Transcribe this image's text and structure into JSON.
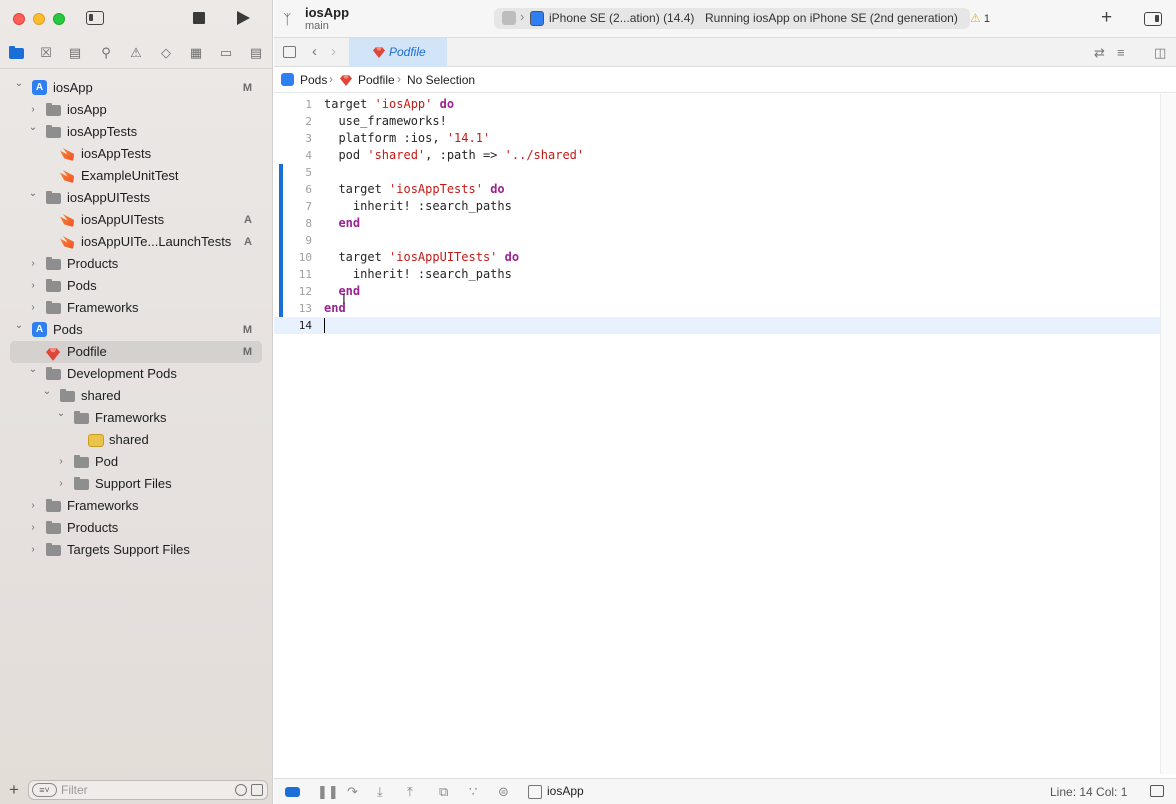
{
  "toolbar": {
    "project_name": "iosApp",
    "branch": "main",
    "device": "iPhone SE (2...ation) (14.4)",
    "run_status": "Running iosApp on iPhone SE (2nd generation)",
    "warning_count": "1"
  },
  "navigator": {
    "tree": [
      {
        "label": "iosApp",
        "icon": "project-icon",
        "level": 0,
        "expanded": true,
        "badge": "M"
      },
      {
        "label": "iosApp",
        "icon": "folder-icon",
        "level": 1,
        "expanded": false,
        "badge": ""
      },
      {
        "label": "iosAppTests",
        "icon": "folder-icon",
        "level": 1,
        "expanded": true,
        "badge": ""
      },
      {
        "label": "iosAppTests",
        "icon": "swift-file-icon",
        "level": 2,
        "badge": ""
      },
      {
        "label": "ExampleUnitTest",
        "icon": "swift-file-icon",
        "level": 2,
        "badge": ""
      },
      {
        "label": "iosAppUITests",
        "icon": "folder-icon",
        "level": 1,
        "expanded": true,
        "badge": ""
      },
      {
        "label": "iosAppUITests",
        "icon": "swift-file-icon",
        "level": 2,
        "badge": "A"
      },
      {
        "label": "iosAppUITe...LaunchTests",
        "icon": "swift-file-icon",
        "level": 2,
        "badge": "A"
      },
      {
        "label": "Products",
        "icon": "folder-icon",
        "level": 1,
        "expanded": false,
        "badge": ""
      },
      {
        "label": "Pods",
        "icon": "folder-icon",
        "level": 1,
        "expanded": false,
        "badge": ""
      },
      {
        "label": "Frameworks",
        "icon": "folder-icon",
        "level": 1,
        "expanded": false,
        "badge": ""
      },
      {
        "label": "Pods",
        "icon": "project-icon",
        "level": 0,
        "expanded": true,
        "badge": "M"
      },
      {
        "label": "Podfile",
        "icon": "ruby-icon",
        "level": 1,
        "badge": "M",
        "selected": true
      },
      {
        "label": "Development Pods",
        "icon": "folder-icon",
        "level": 1,
        "expanded": true,
        "badge": ""
      },
      {
        "label": "shared",
        "icon": "folder-icon",
        "level": 2,
        "expanded": true,
        "badge": ""
      },
      {
        "label": "Frameworks",
        "icon": "folder-icon",
        "level": 3,
        "expanded": true,
        "badge": ""
      },
      {
        "label": "shared",
        "icon": "framework-icon",
        "level": 4,
        "badge": ""
      },
      {
        "label": "Pod",
        "icon": "folder-icon",
        "level": 3,
        "expanded": false,
        "badge": ""
      },
      {
        "label": "Support Files",
        "icon": "folder-icon",
        "level": 3,
        "expanded": false,
        "badge": ""
      },
      {
        "label": "Frameworks",
        "icon": "folder-icon",
        "level": 1,
        "expanded": false,
        "badge": ""
      },
      {
        "label": "Products",
        "icon": "folder-icon",
        "level": 1,
        "expanded": false,
        "badge": ""
      },
      {
        "label": "Targets Support Files",
        "icon": "folder-icon",
        "level": 1,
        "expanded": false,
        "badge": ""
      }
    ],
    "filter_placeholder": "Filter"
  },
  "editor": {
    "tab_label": "Podfile",
    "jumpbar": [
      "Pods",
      "Podfile",
      "No Selection"
    ],
    "current_line": 14,
    "lines": [
      [
        [
          "t",
          "target "
        ],
        [
          "s",
          "'iosApp'"
        ],
        [
          "t",
          " "
        ],
        [
          "k",
          "do"
        ]
      ],
      [
        [
          "t",
          "  use_frameworks!"
        ]
      ],
      [
        [
          "t",
          "  platform :ios, "
        ],
        [
          "s",
          "'14.1'"
        ]
      ],
      [
        [
          "t",
          "  pod "
        ],
        [
          "s",
          "'shared'"
        ],
        [
          "t",
          ", :path => "
        ],
        [
          "s",
          "'../shared'"
        ]
      ],
      [],
      [
        [
          "t",
          "  target "
        ],
        [
          "s",
          "'iosAppTests'"
        ],
        [
          "t",
          " "
        ],
        [
          "k",
          "do"
        ]
      ],
      [
        [
          "t",
          "    inherit! :search_paths"
        ]
      ],
      [
        [
          "t",
          "  "
        ],
        [
          "k",
          "end"
        ]
      ],
      [],
      [
        [
          "t",
          "  target "
        ],
        [
          "s",
          "'iosAppUITests'"
        ],
        [
          "t",
          " "
        ],
        [
          "k",
          "do"
        ]
      ],
      [
        [
          "t",
          "    inherit! :search_paths"
        ]
      ],
      [
        [
          "t",
          "  "
        ],
        [
          "k",
          "end"
        ]
      ],
      [
        [
          "k",
          "end"
        ]
      ],
      []
    ]
  },
  "debugbar": {
    "target": "iosApp",
    "position": "Line: 14  Col: 1"
  },
  "colors": {
    "accent": "#1a6ed8",
    "keyword": "#9b2393",
    "string": "#c41a16",
    "current_line": "#e8f2fe"
  }
}
